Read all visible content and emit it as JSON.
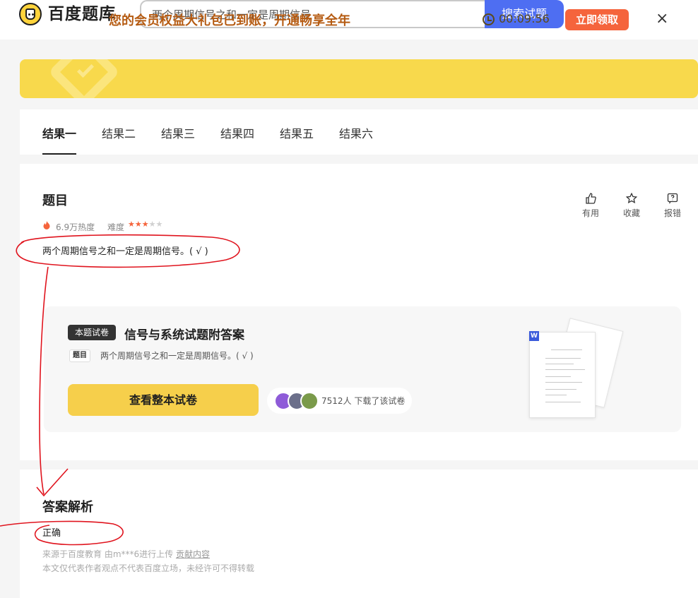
{
  "header": {
    "logo_text": "百度题库",
    "search_value": "两个周期信号之和一定是周期信号",
    "search_button": "搜索试题"
  },
  "banner": {
    "message": "您的会员权益大礼包已到账，开通畅享全年",
    "timer": "00:09:56",
    "claim_button": "立即领取",
    "close": "×"
  },
  "tabs": [
    "结果一",
    "结果二",
    "结果三",
    "结果四",
    "结果五",
    "结果六"
  ],
  "question": {
    "heading": "题目",
    "heat": "6.9万热度",
    "difficulty_label": "难度",
    "difficulty_stars": 3,
    "difficulty_max": 5,
    "text": "两个周期信号之和一定是周期信号。( √ )",
    "actions": [
      "有用",
      "收藏",
      "报错"
    ]
  },
  "exam": {
    "tag": "本题试卷",
    "title": "信号与系统试题附答案",
    "q_tag": "题目",
    "q_text": "两个周期信号之和一定是周期信号。( √ )",
    "view_button": "查看整本试卷",
    "downloads": "7512人 下载了该试卷",
    "doc_badge": "W"
  },
  "answer": {
    "heading": "答案解析",
    "text": "正确",
    "source_prefix": "来源于百度教育 由m***6进行上传",
    "source_link": "贡献内容",
    "disclaimer": "本文仅代表作者观点不代表百度立场，未经许可不得转载"
  },
  "colors": {
    "brand_blue": "#4e6ef2",
    "banner_yellow": "#f8d94c",
    "accent_orange": "#f5643c",
    "annotation_red": "#e0141e"
  }
}
